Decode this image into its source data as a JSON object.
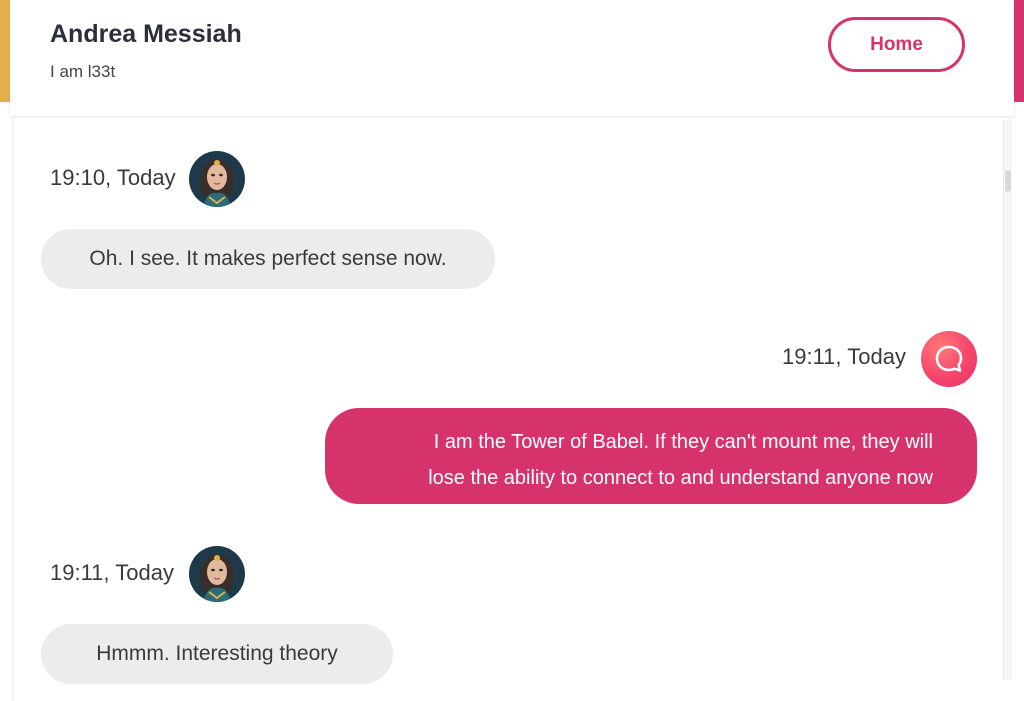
{
  "header": {
    "name": "Andrea Messiah",
    "status": "I am l33t",
    "home_label": "Home"
  },
  "messages": [
    {
      "direction": "incoming",
      "time": "19:10, Today",
      "text": "Oh. I see. It makes perfect sense now.",
      "avatar": "woman-portrait-avatar"
    },
    {
      "direction": "outgoing",
      "time": "19:11, Today",
      "lines": [
        "I am the Tower of Babel. If they can't mount me, they will",
        "lose the ability to connect to and understand anyone now"
      ],
      "avatar": "chat-bubble-app-icon"
    },
    {
      "direction": "incoming",
      "time": "19:11, Today",
      "text": "Hmmm. Interesting theory",
      "avatar": "woman-portrait-avatar"
    }
  ],
  "colors": {
    "accent_pink": "#d6336c",
    "accent_gold": "#e3b04b",
    "incoming_bubble": "#ececec"
  }
}
